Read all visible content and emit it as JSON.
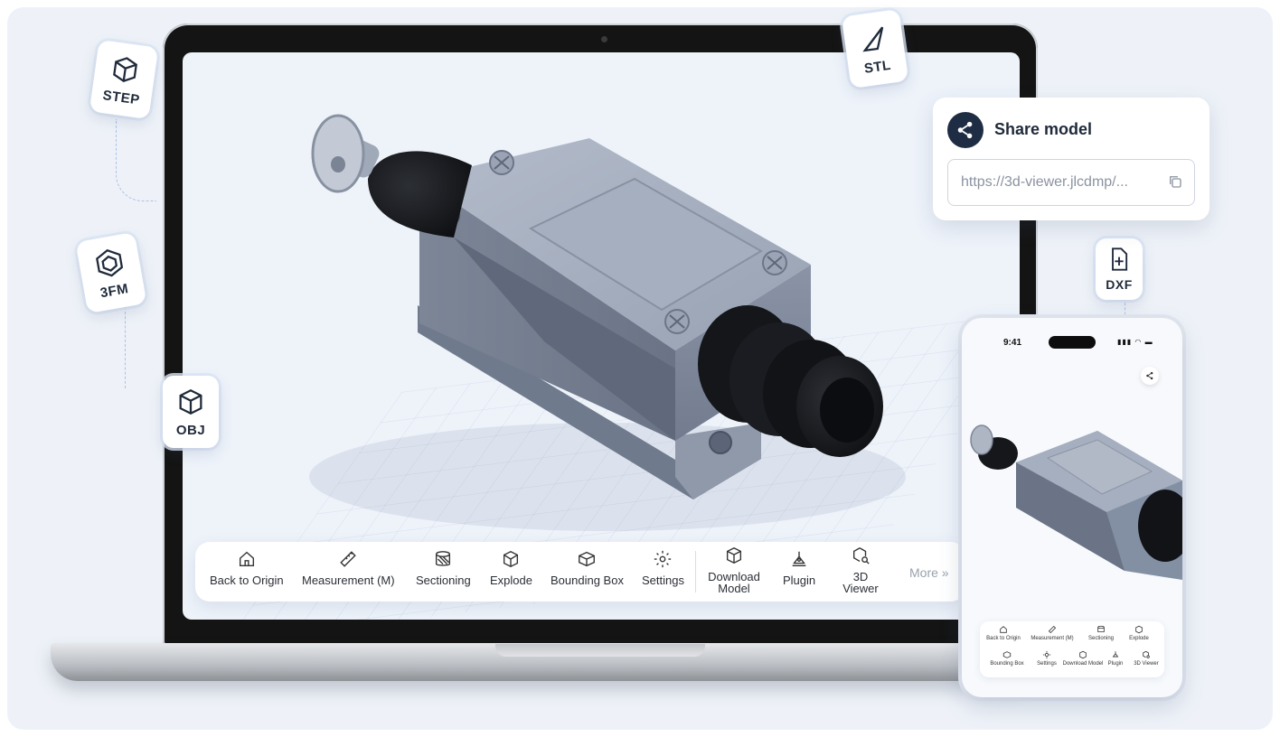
{
  "formats": {
    "step": "STEP",
    "stl": "STL",
    "threefm": "3FM",
    "obj": "OBJ",
    "dxf": "DXF"
  },
  "toolbar": {
    "items": [
      {
        "label": "Back to Origin",
        "icon": "home-icon"
      },
      {
        "label": "Measurement (M)",
        "icon": "ruler-icon"
      },
      {
        "label": "Sectioning",
        "icon": "section-icon"
      },
      {
        "label": "Explode",
        "icon": "explode-icon"
      },
      {
        "label": "Bounding Box",
        "icon": "box-icon"
      },
      {
        "label": "Settings",
        "icon": "gear-icon"
      },
      {
        "label": "Download Model",
        "icon": "cube-download-icon"
      },
      {
        "label": "Plugin",
        "icon": "plugin-icon"
      },
      {
        "label": "3D Viewer",
        "icon": "cube-search-icon"
      }
    ],
    "more": "More »"
  },
  "share": {
    "title": "Share model",
    "url": "https://3d-viewer.jlcdmp/..."
  },
  "phone": {
    "time": "9:41",
    "status": "▮▮▮ ◠ ▬",
    "toolbar_row1": [
      "Back to Origin",
      "Measurement (M)",
      "Sectioning",
      "Explode"
    ],
    "toolbar_row2": [
      "Bounding Box",
      "Settings",
      "Download Model",
      "Plugin",
      "3D Viewer"
    ]
  },
  "colors": {
    "accent_dark": "#1e2d44",
    "model_metal": "#8e98a8",
    "model_rubber": "#1a1c20"
  }
}
